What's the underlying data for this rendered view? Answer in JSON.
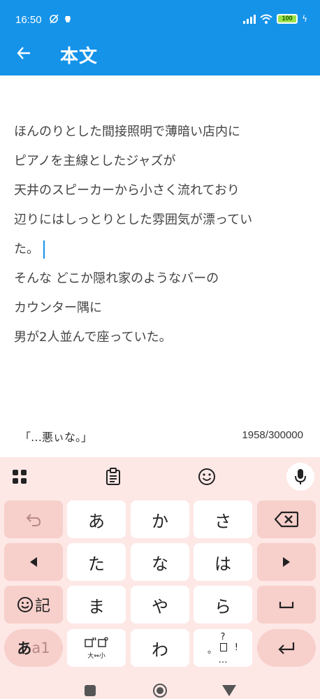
{
  "status_bar": {
    "time": "16:50",
    "battery": "100"
  },
  "app_bar": {
    "title": "本文"
  },
  "editor": {
    "lines": [
      "ほんのりとした間接照明で薄暗い店内に",
      "ピアノを主線としたジャズが",
      "天井のスピーカーから小さく流れており",
      "辺りにはしっとりとした雰囲気が漂ってい",
      "た。",
      "そんな どこか隠れ家のようなバーの",
      "カウンター隅に",
      "男が2人並んで座っていた。"
    ]
  },
  "suggestion": {
    "text": "「…悪ぃな。」",
    "counter": "1958/300000"
  },
  "keyboard": {
    "row1": [
      "あ",
      "か",
      "さ"
    ],
    "row2": [
      "た",
      "な",
      "は"
    ],
    "row3": [
      "ま",
      "や",
      "ら"
    ],
    "row4_center": "わ",
    "emoji_kigo_label": "記",
    "mode_label_kana": "あ",
    "mode_label_alpha": "a1",
    "dakuten_label": "大⇔小",
    "punct_top": "?",
    "punct_left": "。",
    "punct_right": "!",
    "punct_bottom": "…"
  },
  "colors": {
    "primary": "#1593e9",
    "keyboard_bg": "#fde8e6",
    "function_key": "#f7cfcb"
  }
}
